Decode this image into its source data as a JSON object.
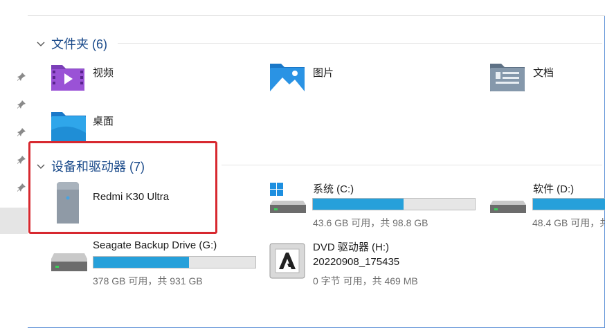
{
  "folders": {
    "header": "文件夹 (6)",
    "items": [
      {
        "label": "视频",
        "icon": "videos-folder-icon"
      },
      {
        "label": "图片",
        "icon": "pictures-folder-icon"
      },
      {
        "label": "文档",
        "icon": "documents-folder-icon"
      },
      {
        "label": "桌面",
        "icon": "desktop-folder-icon"
      }
    ]
  },
  "devices": {
    "header": "设备和驱动器 (7)",
    "items": [
      {
        "label": "Redmi K30 Ultra",
        "icon": "phone-device-icon"
      },
      {
        "label": "系统 (C:)",
        "usage": "43.6 GB 可用，共 98.8 GB",
        "used_fraction": 0.56,
        "icon": "windows-drive-icon"
      },
      {
        "label": "软件 (D:)",
        "usage": "48.4 GB 可用，共",
        "used_fraction": 1.0,
        "icon": "drive-icon"
      },
      {
        "label": "Seagate Backup Drive (G:)",
        "usage": "378 GB 可用，共 931 GB",
        "used_fraction": 0.59,
        "icon": "drive-icon"
      },
      {
        "label": "DVD 驱动器 (H:)",
        "sublabel": "20220908_175435",
        "usage": "0 字节 可用，共 469 MB",
        "icon": "dvd-adobe-icon"
      }
    ]
  },
  "colors": {
    "accent": "#26a0da",
    "header": "#1a4a8a",
    "highlight": "#d7282f"
  }
}
